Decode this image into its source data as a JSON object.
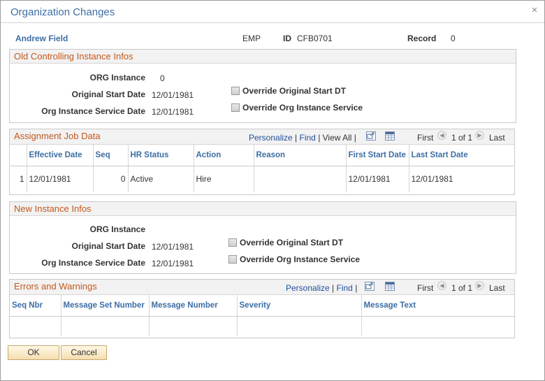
{
  "dialog": {
    "title": "Organization Changes",
    "close_glyph": "×"
  },
  "header": {
    "name": "Andrew Field",
    "emp_label": "EMP",
    "id_label": "ID",
    "id_value": "CFB0701",
    "record_label": "Record",
    "record_value": "0"
  },
  "old_instance": {
    "title": "Old Controlling Instance Infos",
    "org_instance_label": "ORG Instance",
    "org_instance_value": "0",
    "original_start_label": "Original Start Date",
    "original_start_value": "12/01/1981",
    "service_date_label": "Org Instance Service Date",
    "service_date_value": "12/01/1981",
    "override_start_label": "Override Original Start DT",
    "override_service_label": "Override Org Instance Service"
  },
  "assignment": {
    "title": "Assignment Job Data",
    "personalize": "Personalize",
    "find": "Find",
    "view_all": "View All",
    "first": "First",
    "range": "1 of 1",
    "last": "Last",
    "columns": [
      "Effective Date",
      "Seq",
      "HR Status",
      "Action",
      "Reason",
      "First Start Date",
      "Last Start Date"
    ],
    "rows": [
      {
        "row_num": "1",
        "effective_date": "12/01/1981",
        "seq": "0",
        "hr_status": "Active",
        "action": "Hire",
        "reason": "",
        "first_start": "12/01/1981",
        "last_start": "12/01/1981"
      }
    ]
  },
  "new_instance": {
    "title": "New Instance Infos",
    "org_instance_label": "ORG Instance",
    "original_start_label": "Original Start Date",
    "original_start_value": "12/01/1981",
    "service_date_label": "Org Instance Service Date",
    "service_date_value": "12/01/1981",
    "override_start_label": "Override Original Start DT",
    "override_service_label": "Override Org Instance Service"
  },
  "errors": {
    "title": "Errors and Warnings",
    "personalize": "Personalize",
    "find": "Find",
    "first": "First",
    "range": "1 of 1",
    "last": "Last",
    "columns": [
      "Seq Nbr",
      "Message Set Number",
      "Message Number",
      "Severity",
      "Message Text"
    ]
  },
  "buttons": {
    "ok": "OK",
    "cancel": "Cancel"
  },
  "icons": {
    "prev": "triangle-left-icon",
    "next": "triangle-right-icon",
    "zoom": "zoom-window-icon",
    "download": "spreadsheet-icon"
  },
  "colors": {
    "title_blue": "#3c6ea5",
    "section_orange": "#c2591e",
    "link_blue": "#1f4f9c",
    "button_fill": "#f5deb0"
  }
}
